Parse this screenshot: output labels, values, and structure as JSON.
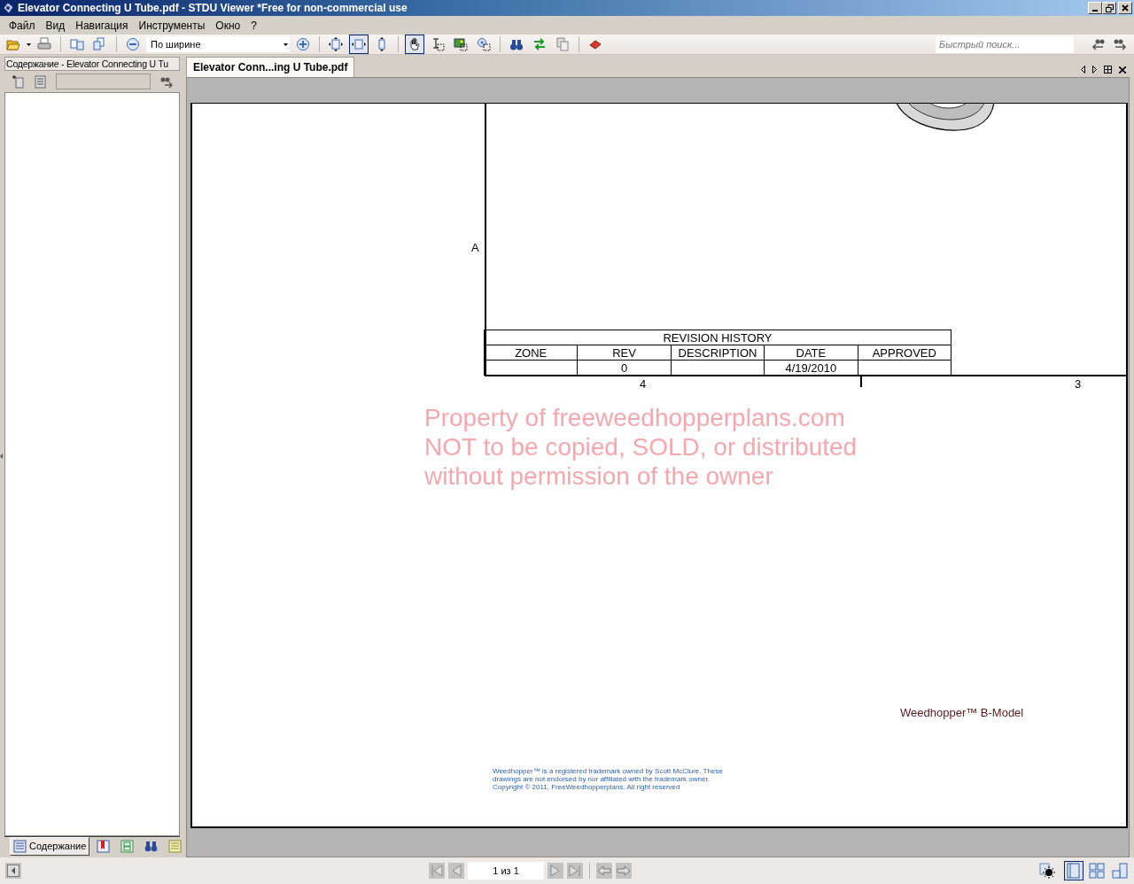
{
  "window": {
    "title": "Elevator Connecting U Tube.pdf - STDU Viewer *Free for non-commercial use"
  },
  "menu": [
    {
      "label": "Файл"
    },
    {
      "label": "Вид"
    },
    {
      "label": "Навигация"
    },
    {
      "label": "Инструменты"
    },
    {
      "label": "Окно"
    },
    {
      "label": "?"
    }
  ],
  "toolbar": {
    "zoom_select": {
      "value": "По ширине"
    },
    "fit_tools": [
      {
        "selected": false
      },
      {
        "selected": true
      },
      {
        "selected": false
      }
    ],
    "pointer_tools": [
      {
        "selected": true
      },
      {
        "selected": false
      },
      {
        "selected": false
      },
      {
        "selected": false
      }
    ],
    "quick_search": {
      "placeholder": "Быстрый поиск..."
    }
  },
  "sidebar": {
    "title": "Содержание - Elevator Connecting U Tu",
    "bottom_tabs": [
      {
        "label": "Содержание",
        "selected": true
      },
      {
        "selected": false
      },
      {
        "selected": false
      },
      {
        "selected": false
      },
      {
        "selected": false
      }
    ]
  },
  "document_tabs": [
    {
      "label": "Elevator Conn...ing U Tube.pdf",
      "selected": true
    }
  ],
  "page": {
    "zone_label": "A",
    "column_numbers": [
      "4",
      "3"
    ],
    "revision_history": {
      "title": "REVISION HISTORY",
      "columns": [
        "ZONE",
        "REV",
        "DESCRIPTION",
        "DATE",
        "APPROVED"
      ],
      "rows": [
        [
          "",
          "0",
          "",
          "4/19/2010",
          ""
        ]
      ]
    },
    "notice": [
      "Property of freeweedhopperplans.com",
      "NOT to be copied, SOLD, or distributed",
      "without permission of the owner"
    ],
    "model_label": "Weedhopper™ B-Model",
    "footer": [
      "Weedhopper™ is a registered trademark owned by Scott McClure. These",
      "drawings are not endorsed by nor affiliated with the trademark owner.",
      "Copyright © 2011, FreeWeedhopperplans. All right reserved"
    ]
  },
  "status_bar": {
    "page_indicator": "1 из 1",
    "view_modes": [
      {
        "selected": true
      },
      {
        "selected": false
      },
      {
        "selected": false
      }
    ]
  }
}
